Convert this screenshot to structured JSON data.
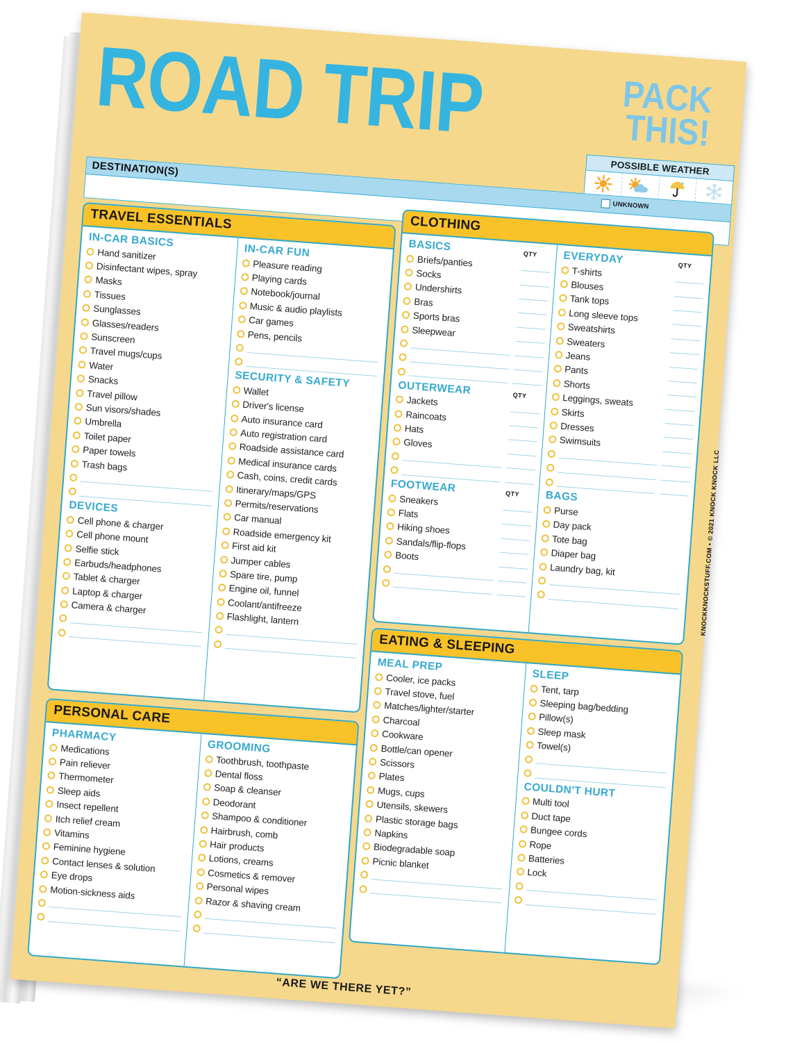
{
  "header": {
    "title_main": "ROAD TRIP",
    "title_sub_line1": "PACK",
    "title_sub_line2": "THIS!",
    "weather_label": "POSSIBLE WEATHER",
    "weather_icons": [
      "sun-icon",
      "sun-behind-cloud-icon",
      "umbrella-icon",
      "snowflake-icon"
    ],
    "destination_label": "DESTINATION(S)",
    "destination_value": "",
    "unknown_label": "UNKNOWN",
    "unknown_checked": false
  },
  "colors": {
    "paper": "#f6d88c",
    "accent_blue": "#35b4e0",
    "header_yellow": "#f9c229",
    "border_teal": "#2fa8ca",
    "bullet_gold": "#eec23f",
    "bar_blue": "#a9d9ef"
  },
  "panels": [
    {
      "id": "travel-essentials",
      "title": "TRAVEL ESSENTIALS",
      "columns": [
        {
          "groups": [
            {
              "name": "IN-CAR BASICS",
              "qty": false,
              "items": [
                "Hand sanitizer",
                "Disinfectant wipes, spray",
                "Masks",
                "Tissues",
                "Sunglasses",
                "Glasses/readers",
                "Sunscreen",
                "Travel mugs/cups",
                "Water",
                "Snacks",
                "Travel pillow",
                "Sun visors/shades",
                "Umbrella",
                "Toilet paper",
                "Paper towels",
                "Trash bags"
              ],
              "blanks": 2
            },
            {
              "name": "DEVICES",
              "qty": false,
              "items": [
                "Cell phone & charger",
                "Cell phone mount",
                "Selfie stick",
                "Earbuds/headphones",
                "Tablet & charger",
                "Laptop & charger",
                "Camera & charger"
              ],
              "blanks": 2
            }
          ]
        },
        {
          "groups": [
            {
              "name": "IN-CAR FUN",
              "qty": false,
              "items": [
                "Pleasure reading",
                "Playing cards",
                "Notebook/journal",
                "Music & audio playlists",
                "Car games",
                "Pens, pencils"
              ],
              "blanks": 2
            },
            {
              "name": "SECURITY & SAFETY",
              "qty": false,
              "items": [
                "Wallet",
                "Driver's license",
                "Auto insurance card",
                "Auto registration card",
                "Roadside assistance card",
                "Medical insurance cards",
                "Cash, coins, credit cards",
                "Itinerary/maps/GPS",
                "Permits/reservations",
                "Car manual",
                "Roadside emergency kit",
                "First aid kit",
                "Jumper cables",
                "Spare tire, pump",
                "Engine oil, funnel",
                "Coolant/antifreeze",
                "Flashlight, lantern"
              ],
              "blanks": 2
            }
          ]
        }
      ]
    },
    {
      "id": "clothing",
      "title": "CLOTHING",
      "columns": [
        {
          "groups": [
            {
              "name": "BASICS",
              "qty": true,
              "qty_label": "QTY",
              "items": [
                "Briefs/panties",
                "Socks",
                "Undershirts",
                "Bras",
                "Sports bras",
                "Sleepwear"
              ],
              "blanks": 3
            },
            {
              "name": "OUTERWEAR",
              "qty": true,
              "qty_label": "QTY",
              "items": [
                "Jackets",
                "Raincoats",
                "Hats",
                "Gloves"
              ],
              "blanks": 2
            },
            {
              "name": "FOOTWEAR",
              "qty": true,
              "qty_label": "QTY",
              "items": [
                "Sneakers",
                "Flats",
                "Hiking shoes",
                "Sandals/flip-flops",
                "Boots"
              ],
              "blanks": 2
            }
          ]
        },
        {
          "groups": [
            {
              "name": "EVERYDAY",
              "qty": true,
              "qty_label": "QTY",
              "items": [
                "T-shirts",
                "Blouses",
                "Tank tops",
                "Long sleeve tops",
                "Sweatshirts",
                "Sweaters",
                "Jeans",
                "Pants",
                "Shorts",
                "Leggings, sweats",
                "Skirts",
                "Dresses",
                "Swimsuits"
              ],
              "blanks": 3
            },
            {
              "name": "BAGS",
              "qty": false,
              "items": [
                "Purse",
                "Day pack",
                "Tote bag",
                "Diaper bag",
                "Laundry bag, kit"
              ],
              "blanks": 2
            }
          ]
        }
      ]
    },
    {
      "id": "eating-sleeping",
      "title": "EATING & SLEEPING",
      "columns": [
        {
          "groups": [
            {
              "name": "MEAL PREP",
              "qty": false,
              "items": [
                "Cooler, ice packs",
                "Travel stove, fuel",
                "Matches/lighter/starter",
                "Charcoal",
                "Cookware",
                "Bottle/can opener",
                "Scissors",
                "Plates",
                "Mugs, cups",
                "Utensils, skewers",
                "Plastic storage bags",
                "Napkins",
                "Biodegradable soap",
                "Picnic blanket"
              ],
              "blanks": 2
            }
          ]
        },
        {
          "groups": [
            {
              "name": "SLEEP",
              "qty": false,
              "items": [
                "Tent, tarp",
                "Sleeping bag/bedding",
                "Pillow(s)",
                "Sleep mask",
                "Towel(s)"
              ],
              "blanks": 2
            },
            {
              "name": "COULDN'T HURT",
              "qty": false,
              "items": [
                "Multi tool",
                "Duct tape",
                "Bungee cords",
                "Rope",
                "Batteries",
                "Lock"
              ],
              "blanks": 2
            }
          ]
        }
      ]
    },
    {
      "id": "personal-care",
      "title": "PERSONAL CARE",
      "columns": [
        {
          "groups": [
            {
              "name": "PHARMACY",
              "qty": false,
              "items": [
                "Medications",
                "Pain reliever",
                "Thermometer",
                "Sleep aids",
                "Insect repellent",
                "Itch relief cream",
                "Vitamins",
                "Feminine hygiene",
                "Contact lenses & solution",
                "Eye drops",
                "Motion-sickness aids"
              ],
              "blanks": 2
            }
          ]
        },
        {
          "groups": [
            {
              "name": "GROOMING",
              "qty": false,
              "items": [
                "Toothbrush, toothpaste",
                "Dental floss",
                "Soap & cleanser",
                "Deodorant",
                "Shampoo & conditioner",
                "Hairbrush, comb",
                "Hair products",
                "Lotions, creams",
                "Cosmetics & remover",
                "Personal wipes",
                "Razor & shaving cream"
              ],
              "blanks": 2
            }
          ]
        }
      ]
    }
  ],
  "footer": {
    "tagline": "“ARE WE THERE YET?”",
    "credit": "KNOCKKNOCKSTUFF.COM • © 2021 KNOCK KNOCK LLC"
  }
}
